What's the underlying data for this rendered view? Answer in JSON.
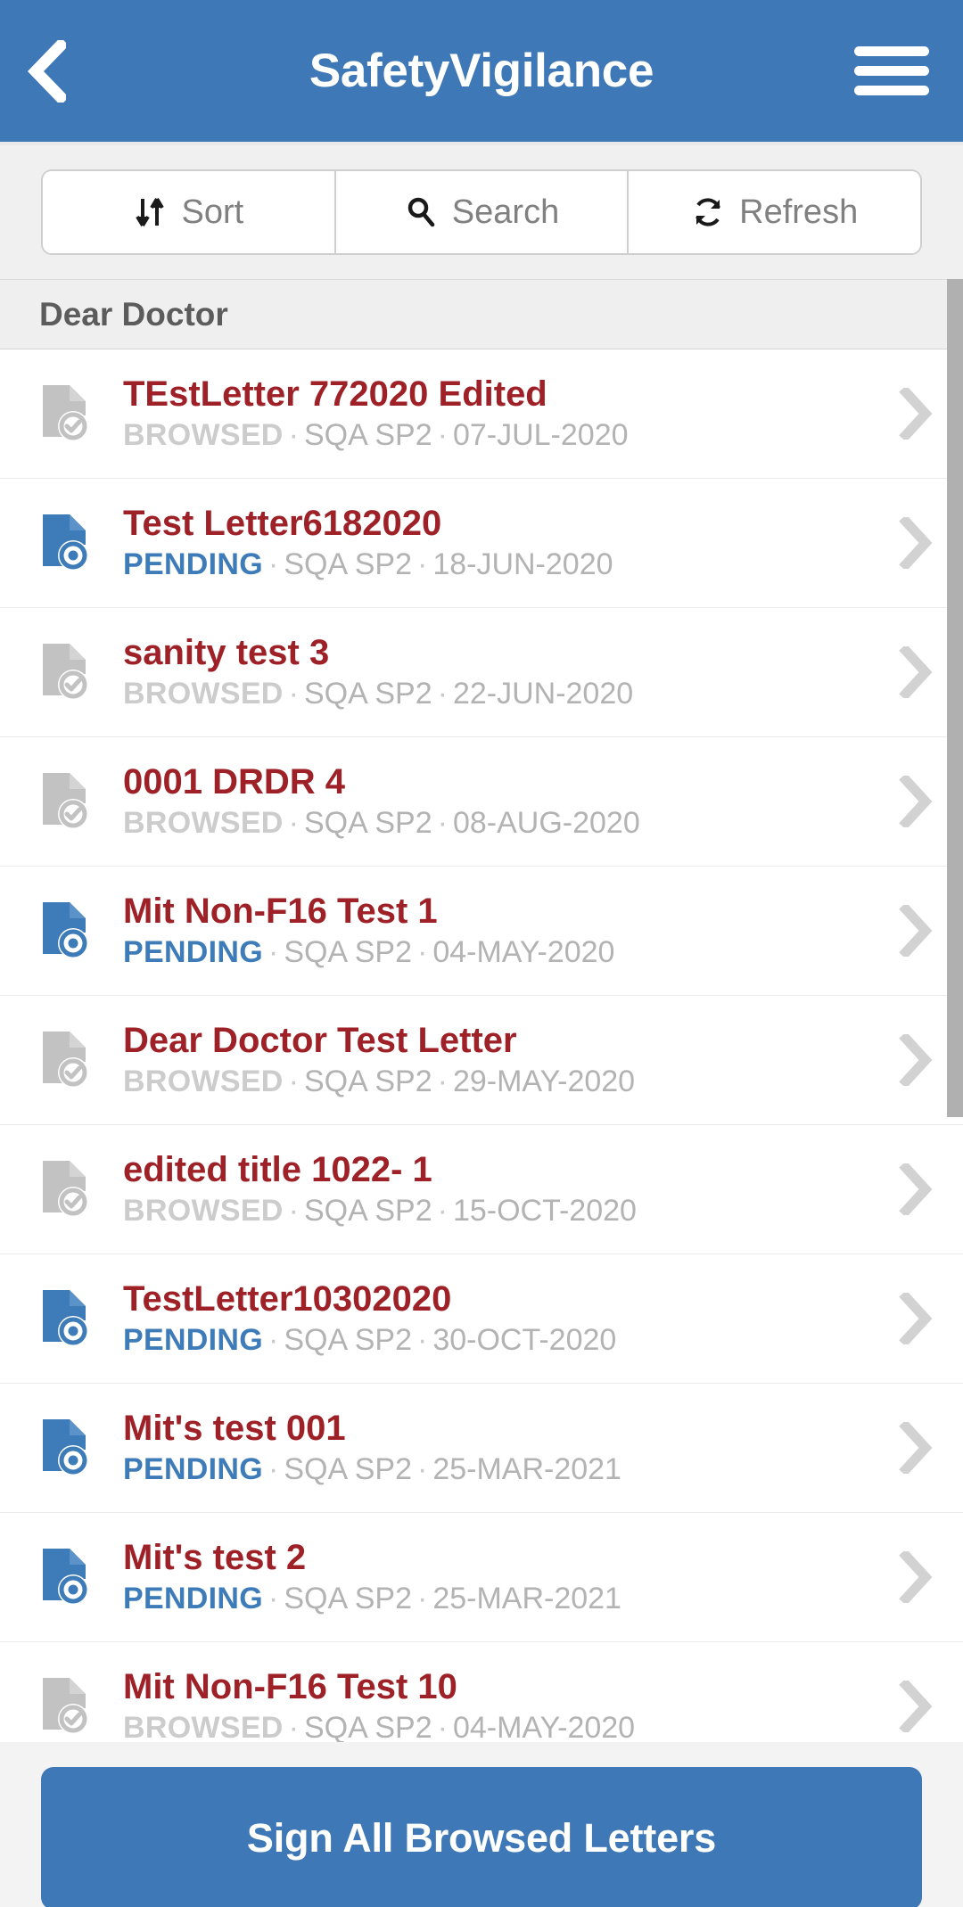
{
  "header": {
    "title": "SafetyVigilance",
    "back_icon": "chevron-left-icon",
    "menu_icon": "hamburger-menu-icon",
    "background_color": "#3f78b6"
  },
  "toolbar": {
    "sort_label": "Sort",
    "sort_icon": "sort-arrows-icon",
    "search_label": "Search",
    "search_icon": "search-icon",
    "refresh_label": "Refresh",
    "refresh_icon": "refresh-icon"
  },
  "list": {
    "section_title": "Dear Doctor",
    "separator": "·",
    "chevron_icon": "chevron-right-icon",
    "status_colors": {
      "browsed": "#cccccc",
      "pending": "#3d7cb8"
    },
    "title_color": "#9e2127",
    "items": [
      {
        "title": "TEstLetter 772020 Edited",
        "status": "BROWSED",
        "source": "SQA SP2",
        "date": "07-JUL-2020",
        "icon": "document-check-icon"
      },
      {
        "title": "Test Letter6182020",
        "status": "PENDING",
        "source": "SQA SP2",
        "date": "18-JUN-2020",
        "icon": "document-pending-icon"
      },
      {
        "title": "sanity test 3",
        "status": "BROWSED",
        "source": "SQA SP2",
        "date": "22-JUN-2020",
        "icon": "document-check-icon"
      },
      {
        "title": "0001 DRDR 4",
        "status": "BROWSED",
        "source": "SQA SP2",
        "date": "08-AUG-2020",
        "icon": "document-check-icon"
      },
      {
        "title": "Mit Non-F16 Test 1",
        "status": "PENDING",
        "source": "SQA SP2",
        "date": "04-MAY-2020",
        "icon": "document-pending-icon"
      },
      {
        "title": "Dear Doctor Test Letter",
        "status": "BROWSED",
        "source": "SQA SP2",
        "date": "29-MAY-2020",
        "icon": "document-check-icon"
      },
      {
        "title": "edited title 1022- 1",
        "status": "BROWSED",
        "source": "SQA SP2",
        "date": "15-OCT-2020",
        "icon": "document-check-icon"
      },
      {
        "title": "TestLetter10302020",
        "status": "PENDING",
        "source": "SQA SP2",
        "date": "30-OCT-2020",
        "icon": "document-pending-icon"
      },
      {
        "title": "Mit's test 001",
        "status": "PENDING",
        "source": "SQA SP2",
        "date": "25-MAR-2021",
        "icon": "document-pending-icon"
      },
      {
        "title": "Mit's test 2",
        "status": "PENDING",
        "source": "SQA SP2",
        "date": "25-MAR-2021",
        "icon": "document-pending-icon"
      },
      {
        "title": "Mit Non-F16 Test 10",
        "status": "BROWSED",
        "source": "SQA SP2",
        "date": "04-MAY-2020",
        "icon": "document-check-icon"
      }
    ]
  },
  "footer": {
    "sign_label": "Sign All Browsed Letters",
    "button_color": "#3f78b6"
  }
}
